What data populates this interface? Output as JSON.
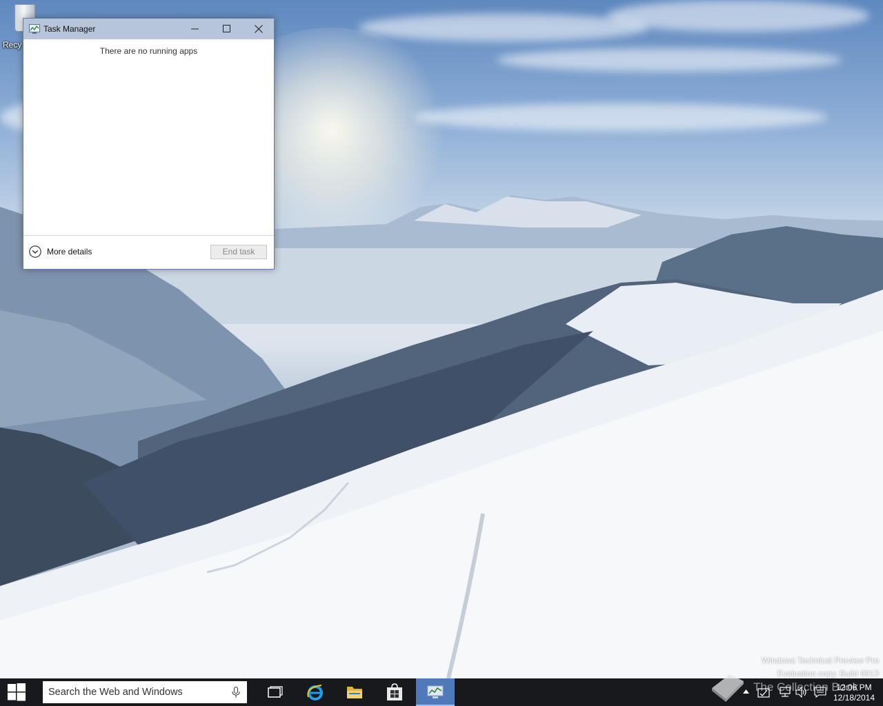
{
  "desktop": {
    "recycle_bin_label": "Recy"
  },
  "task_manager": {
    "title": "Task Manager",
    "empty_message": "There are no running apps",
    "more_details_label": "More details",
    "end_task_label": "End task"
  },
  "watermark": {
    "line1": "Windows Technical Preview Pro",
    "line2": "Evaluation copy. Build 9913"
  },
  "overlay_logo": {
    "text": "The Collection Book"
  },
  "taskbar": {
    "search_placeholder": "Search the Web and Windows",
    "apps": [
      "task-view",
      "internet-explorer",
      "file-explorer",
      "store",
      "task-manager"
    ],
    "active_app": "task-manager",
    "accent_color": "#4f79b9",
    "clock": {
      "time": "12:06 PM",
      "date": "12/18/2014"
    }
  }
}
